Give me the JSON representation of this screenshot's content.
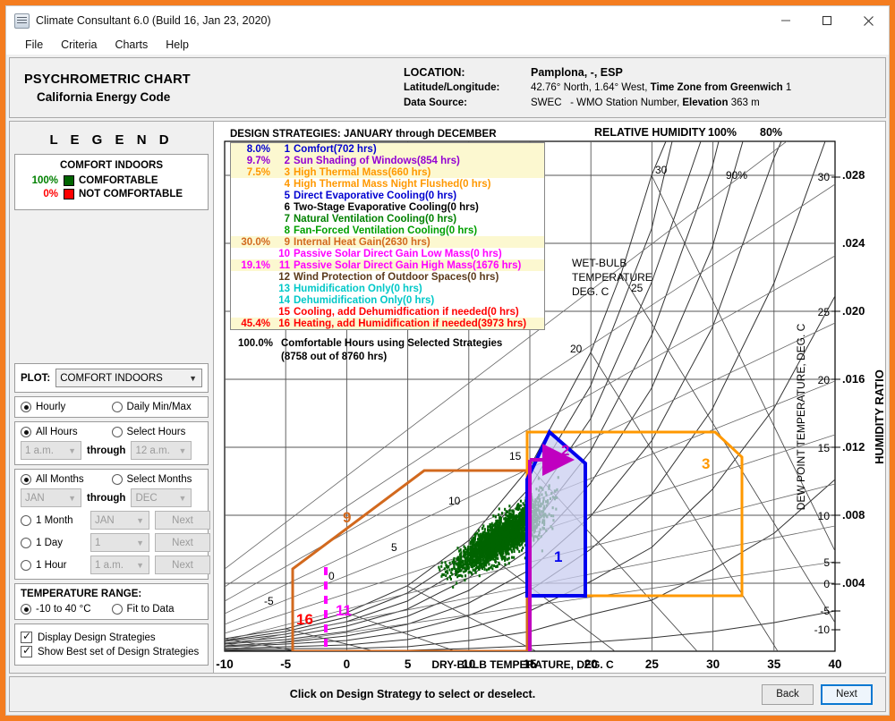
{
  "window": {
    "title": "Climate Consultant 6.0 (Build 16, Jan 23, 2020)",
    "minimize": "minimize-icon",
    "maximize": "maximize-icon",
    "close": "close-icon"
  },
  "menu": [
    "File",
    "Criteria",
    "Charts",
    "Help"
  ],
  "header": {
    "title_line1": "PSYCHROMETRIC CHART",
    "title_line2": "California Energy Code",
    "location_label": "LOCATION:",
    "location_value": "Pamplona, -, ESP",
    "latlong_label": "Latitude/Longitude:",
    "latlong_value": "42.76° North, 1.64° West,",
    "timezone_label": "Time Zone from Greenwich",
    "timezone_value": "1",
    "datasource_label": "Data Source:",
    "datasource_value": "SWEC",
    "wmo_text": "- WMO Station Number,",
    "elevation_label": "Elevation",
    "elevation_value": "363 m"
  },
  "legend": {
    "title": "L E G E N D",
    "heading": "COMFORT INDOORS",
    "rows": [
      {
        "pct": "100%",
        "label": "COMFORTABLE",
        "color": "#006400",
        "pct_color": "#008000"
      },
      {
        "pct": "0%",
        "label": "NOT COMFORTABLE",
        "color": "#ff0000",
        "pct_color": "#ff0000"
      }
    ]
  },
  "controls": {
    "plot_label": "PLOT:",
    "plot_value": "COMFORT INDOORS",
    "hourly": "Hourly",
    "daily": "Daily Min/Max",
    "all_hours": "All Hours",
    "select_hours": "Select Hours",
    "hour_from": "1 a.m.",
    "hour_through": "through",
    "hour_to": "12 a.m.",
    "all_months": "All Months",
    "select_months": "Select Months",
    "month_from": "JAN",
    "month_through": "through",
    "month_to": "DEC",
    "one_month": "1 Month",
    "one_month_value": "JAN",
    "one_day": "1 Day",
    "one_day_value": "1",
    "one_hour": "1 Hour",
    "one_hour_value": "1 a.m.",
    "next": "Next",
    "temp_range_title": "TEMPERATURE RANGE:",
    "temp_fixed": "-10 to 40 °C",
    "temp_fit": "Fit to Data",
    "display_strategies": "Display Design Strategies",
    "show_best": "Show Best set of Design Strategies"
  },
  "strategies": {
    "header": "DESIGN STRATEGIES:  JANUARY through DECEMBER",
    "items": [
      {
        "pct": "8.0%",
        "num": "1",
        "label": "Comfort(702 hrs)",
        "color": "#0000d0",
        "selected": true
      },
      {
        "pct": "9.7%",
        "num": "2",
        "label": "Sun Shading of Windows(854 hrs)",
        "color": "#9400d3",
        "selected": true
      },
      {
        "pct": "7.5%",
        "num": "3",
        "label": "High Thermal Mass(660 hrs)",
        "color": "#ff9800",
        "selected": true
      },
      {
        "pct": "",
        "num": "4",
        "label": "High Thermal Mass Night Flushed(0 hrs)",
        "color": "#ff9800",
        "selected": false
      },
      {
        "pct": "",
        "num": "5",
        "label": "Direct Evaporative Cooling(0 hrs)",
        "color": "#0000d0",
        "selected": false
      },
      {
        "pct": "",
        "num": "6",
        "label": "Two-Stage Evaporative Cooling(0 hrs)",
        "color": "#000000",
        "selected": false
      },
      {
        "pct": "",
        "num": "7",
        "label": "Natural Ventilation Cooling(0 hrs)",
        "color": "#008000",
        "selected": false
      },
      {
        "pct": "",
        "num": "8",
        "label": "Fan-Forced Ventilation Cooling(0 hrs)",
        "color": "#00a000",
        "selected": false
      },
      {
        "pct": "30.0%",
        "num": "9",
        "label": "Internal Heat Gain(2630 hrs)",
        "color": "#d2691e",
        "selected": true
      },
      {
        "pct": "",
        "num": "10",
        "label": "Passive Solar Direct Gain Low Mass(0 hrs)",
        "color": "#ff00ff",
        "selected": false
      },
      {
        "pct": "19.1%",
        "num": "11",
        "label": "Passive Solar Direct Gain High Mass(1676 hrs)",
        "color": "#ff00ff",
        "selected": true
      },
      {
        "pct": "",
        "num": "12",
        "label": "Wind Protection of Outdoor Spaces(0 hrs)",
        "color": "#5b3a1a",
        "selected": false
      },
      {
        "pct": "",
        "num": "13",
        "label": "Humidification Only(0 hrs)",
        "color": "#00c8c8",
        "selected": false
      },
      {
        "pct": "",
        "num": "14",
        "label": "Dehumidification Only(0 hrs)",
        "color": "#00c8c8",
        "selected": false
      },
      {
        "pct": "",
        "num": "15",
        "label": "Cooling, add Dehumidfication if needed(0 hrs)",
        "color": "#ff0000",
        "selected": false
      },
      {
        "pct": "45.4%",
        "num": "16",
        "label": "Heating, add Humidification if needed(3973 hrs)",
        "color": "#ff0000",
        "selected": true
      }
    ],
    "summary_pct": "100.0%",
    "summary_line1": "Comfortable Hours using Selected Strategies",
    "summary_line2": "(8758 out of 8760 hrs)"
  },
  "chart_data": {
    "type": "scatter",
    "title": "PSYCHROMETRIC CHART",
    "xlabel": "DRY-BULB TEMPERATURE, DEG. C",
    "ylabel": "HUMIDITY RATIO",
    "ylabel_right_inner": "DEW POINT TEMPERATURE, DEG. C",
    "wetbulb_label": "WET-BULB TEMPERATURE DEG. C",
    "rh_label": "RELATIVE HUMIDITY",
    "xlim": [
      -10,
      40
    ],
    "xticks": [
      -10,
      -5,
      0,
      5,
      10,
      15,
      20,
      25,
      30,
      35,
      40
    ],
    "ylim": [
      0,
      0.03
    ],
    "yticks": [
      0.004,
      0.008,
      0.012,
      0.016,
      0.02,
      0.024,
      0.028
    ],
    "ytick_labels": [
      ".004",
      ".008",
      ".012",
      ".016",
      ".020",
      ".024",
      ".028"
    ],
    "rh_curves": [
      100,
      90,
      80,
      70,
      60,
      50,
      40,
      30,
      20,
      10
    ],
    "rh_labeled": [
      "100%",
      "90%",
      "80%"
    ],
    "wetbulb_ticks": [
      -5,
      0,
      5,
      10,
      15,
      20,
      25,
      30
    ],
    "dewpoint_ticks": [
      -10,
      -5,
      0,
      5,
      10,
      15,
      20,
      25,
      30
    ],
    "grid": true,
    "legend_position": "left-panel",
    "series": [
      {
        "name": "COMFORTABLE",
        "color": "#006400",
        "point_count": 8758
      },
      {
        "name": "NOT COMFORTABLE",
        "color": "#ff0000",
        "point_count": 2
      }
    ],
    "zones": [
      {
        "id": "1",
        "name": "Comfort",
        "color": "#0000ee",
        "fill": "#c9cdf0",
        "label": "1"
      },
      {
        "id": "2",
        "name": "Sun Shading of Windows",
        "color": "#c000c0",
        "label": "2"
      },
      {
        "id": "3",
        "name": "High Thermal Mass",
        "color": "#ff9800",
        "label": "3"
      },
      {
        "id": "9",
        "name": "Internal Heat Gain",
        "color": "#d2691e",
        "label": "9"
      },
      {
        "id": "11",
        "name": "Passive Solar Direct Gain High Mass",
        "color": "#ff00ff",
        "label": "11"
      },
      {
        "id": "16",
        "name": "Heating, add Humidification if needed",
        "color": "#ff0000",
        "label": "16"
      }
    ]
  },
  "footer": {
    "message": "Click on Design Strategy to select or deselect.",
    "back": "Back",
    "next": "Next"
  }
}
